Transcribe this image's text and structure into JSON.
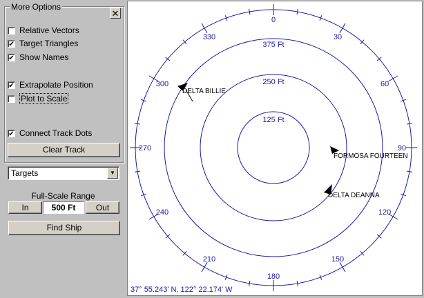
{
  "options": {
    "title": "More Options",
    "close_glyph": "✕",
    "checkboxes": [
      {
        "label": "Relative Vectors",
        "checked": false
      },
      {
        "label": "Target Triangles",
        "checked": true
      },
      {
        "label": "Show Names",
        "checked": true
      },
      {
        "label": "Extrapolate Position",
        "checked": true
      },
      {
        "label": "Plot to Scale",
        "checked": false
      },
      {
        "label": "Connect Track Dots",
        "checked": true
      }
    ],
    "clear_track_label": "Clear Track"
  },
  "targets_select": {
    "value": "Targets"
  },
  "range": {
    "label": "Full-Scale Range",
    "in_label": "In",
    "value": "500 Ft",
    "out_label": "Out"
  },
  "find_ship_label": "Find Ship",
  "radar": {
    "ring_labels": [
      "125 Ft",
      "250 Ft",
      "375 Ft"
    ],
    "bearings": [
      "0",
      "30",
      "60",
      "90",
      "120",
      "150",
      "180",
      "210",
      "240",
      "270",
      "300",
      "330"
    ],
    "targets": [
      {
        "name": "DELTA BILLIE"
      },
      {
        "name": "FORMOSA FOURTEEN"
      },
      {
        "name": "DELTA DEANNA"
      }
    ],
    "status": "37° 55.243' N, 122° 22.174' W",
    "line_color": "#1a1aa0"
  }
}
